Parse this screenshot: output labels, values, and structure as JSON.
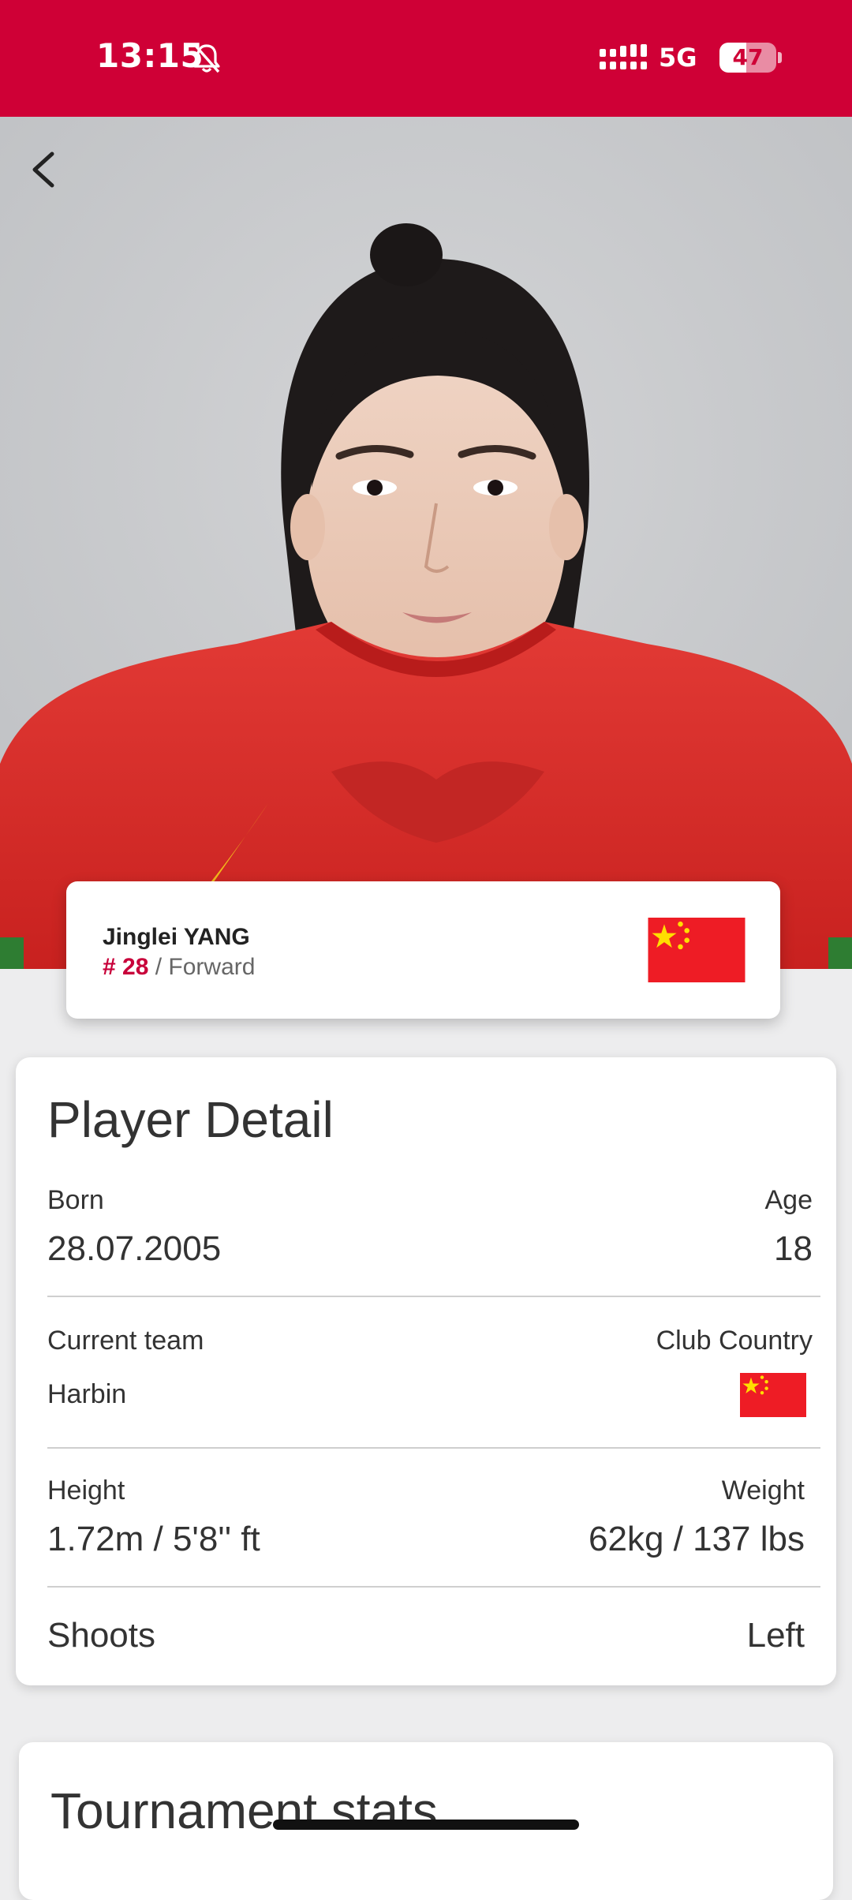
{
  "status_bar": {
    "time": "13:15",
    "network": "5G",
    "battery": "47",
    "battery_level": 0.47,
    "icons": [
      "bell-muted-icon",
      "signal-icon",
      "battery-icon"
    ],
    "background": "#cf0036"
  },
  "header": {
    "back_icon": "chevron-left-icon"
  },
  "player": {
    "name": "Jinglei YANG",
    "number": "# 28",
    "separator": " / ",
    "position": "Forward",
    "flag": "china-flag-icon"
  },
  "detail": {
    "title": "Player Detail",
    "born_label": "Born",
    "born_value": "28.07.2005",
    "age_label": "Age",
    "age_value": "18",
    "team_label": "Current team",
    "team_value": "Harbin",
    "club_country_label": "Club Country",
    "club_country_flag": "china-flag-icon",
    "height_label": "Height",
    "height_value": "1.72m / 5'8'' ft",
    "weight_label": "Weight",
    "weight_value": "62kg / 137 lbs",
    "shoots_label": "Shoots",
    "shoots_value": "Left"
  },
  "stats": {
    "title": "Tournament stats"
  },
  "colors": {
    "accent": "#cf0036",
    "number": "#c8003a",
    "flag_red": "#ee1c25",
    "flag_star": "#ffde00"
  }
}
